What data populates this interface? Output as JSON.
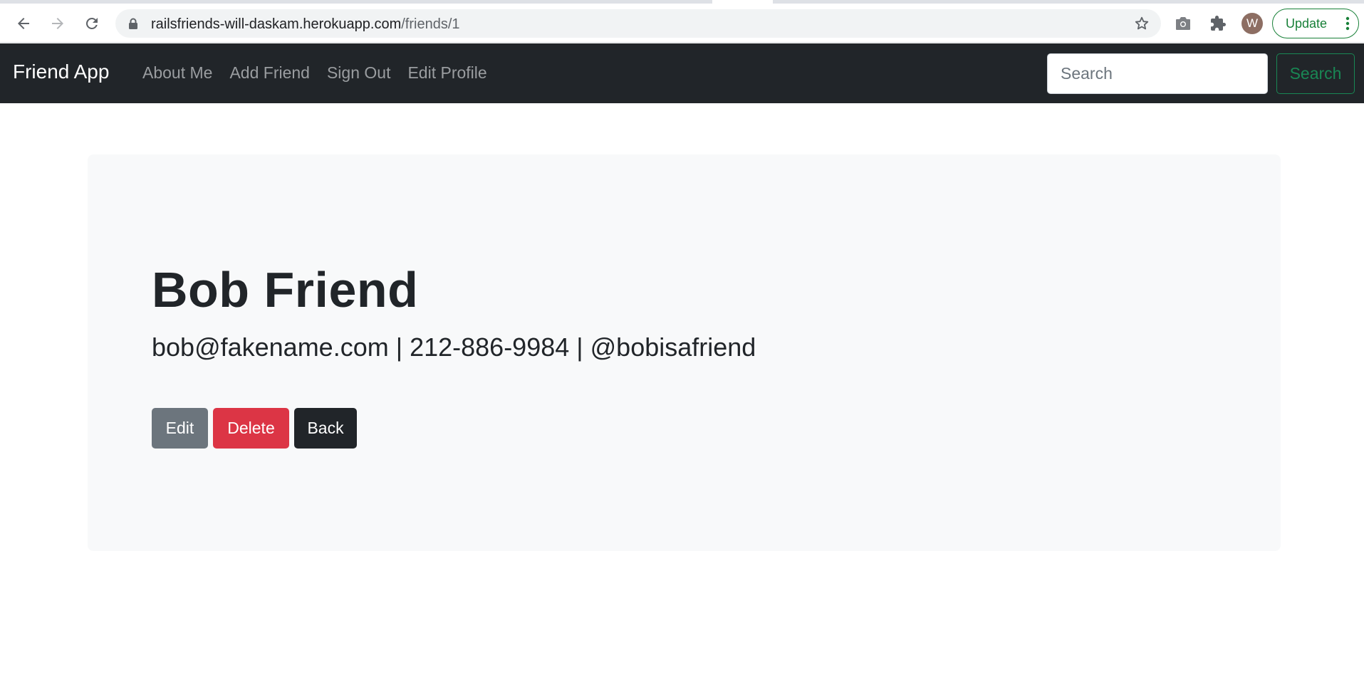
{
  "browser": {
    "url_host": "railsfriends-will-daskam.herokuapp.com",
    "url_path": "/friends/1",
    "profile_initial": "W",
    "update_label": "Update",
    "accent_color": "#188038"
  },
  "navbar": {
    "brand": "Friend App",
    "links": [
      "About Me",
      "Add Friend",
      "Sign Out",
      "Edit Profile"
    ],
    "search_placeholder": "Search",
    "search_button": "Search"
  },
  "friend": {
    "name": "Bob Friend",
    "details": "bob@fakename.com | 212-886-9984 | @bobisafriend"
  },
  "actions": {
    "edit": "Edit",
    "delete": "Delete",
    "back": "Back"
  },
  "colors": {
    "navbar_bg": "#212529",
    "card_bg": "#f8f9fa",
    "edit_btn": "#6c757d",
    "delete_btn": "#dc3545",
    "back_btn": "#212529",
    "search_btn": "#198754"
  }
}
